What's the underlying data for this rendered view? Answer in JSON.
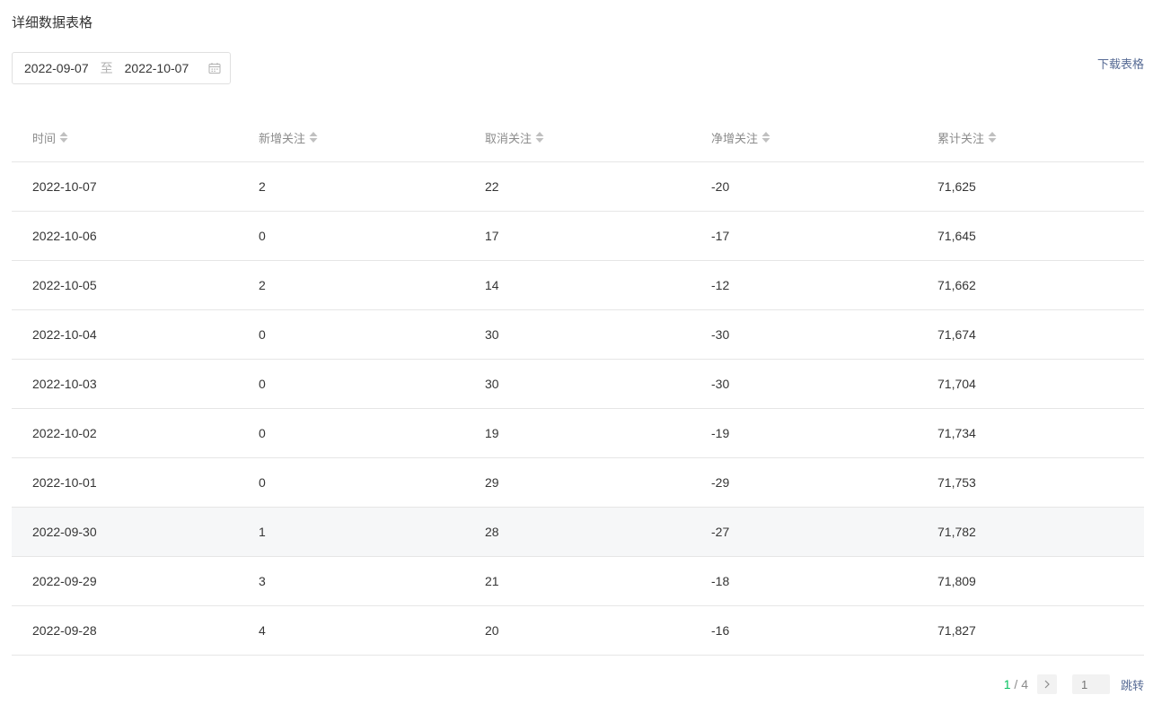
{
  "title": "详细数据表格",
  "date_range": {
    "start": "2022-09-07",
    "separator": "至",
    "end": "2022-10-07"
  },
  "download_label": "下载表格",
  "table": {
    "headers": [
      "时间",
      "新增关注",
      "取消关注",
      "净增关注",
      "累计关注"
    ],
    "rows": [
      [
        "2022-10-07",
        "2",
        "22",
        "-20",
        "71,625"
      ],
      [
        "2022-10-06",
        "0",
        "17",
        "-17",
        "71,645"
      ],
      [
        "2022-10-05",
        "2",
        "14",
        "-12",
        "71,662"
      ],
      [
        "2022-10-04",
        "0",
        "30",
        "-30",
        "71,674"
      ],
      [
        "2022-10-03",
        "0",
        "30",
        "-30",
        "71,704"
      ],
      [
        "2022-10-02",
        "0",
        "19",
        "-19",
        "71,734"
      ],
      [
        "2022-10-01",
        "0",
        "29",
        "-29",
        "71,753"
      ],
      [
        "2022-09-30",
        "1",
        "28",
        "-27",
        "71,782"
      ],
      [
        "2022-09-29",
        "3",
        "21",
        "-18",
        "71,809"
      ],
      [
        "2022-09-28",
        "4",
        "20",
        "-16",
        "71,827"
      ]
    ],
    "highlighted_row": 7
  },
  "pagination": {
    "current": "1",
    "separator": " / ",
    "total": "4",
    "input_placeholder": "1",
    "jump_label": "跳转"
  },
  "colors": {
    "accent": "#07c160",
    "link": "#576b95",
    "row_highlight": "#f6f7f8"
  },
  "icons": {
    "date": "calendar-icon",
    "sort": "sort-icon",
    "next": "chevron-right-icon"
  }
}
